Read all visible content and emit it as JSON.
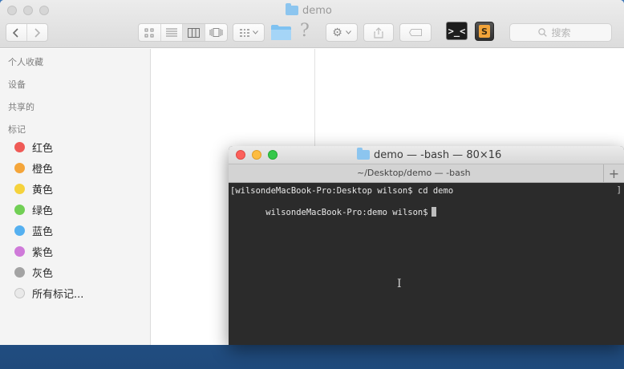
{
  "finder": {
    "title": "demo",
    "search_placeholder": "搜索",
    "sidebar": {
      "sections": [
        "个人收藏",
        "设备",
        "共享的",
        "标记"
      ],
      "tags": [
        {
          "label": "红色",
          "color": "#ef5a56"
        },
        {
          "label": "橙色",
          "color": "#f4a53a"
        },
        {
          "label": "黄色",
          "color": "#f5d23c"
        },
        {
          "label": "绿色",
          "color": "#71cf55"
        },
        {
          "label": "蓝色",
          "color": "#55b0f0"
        },
        {
          "label": "紫色",
          "color": "#cf7ad9"
        },
        {
          "label": "灰色",
          "color": "#a3a3a3"
        }
      ],
      "all_tags_label": "所有标记..."
    }
  },
  "terminal": {
    "title": "demo — -bash — 80×16",
    "tab_label": "~/Desktop/demo — -bash",
    "tab_add": "+",
    "lines": [
      "[wilsondeMacBook-Pro:Desktop wilson$ cd demo",
      " wilsondeMacBook-Pro:demo wilson$"
    ],
    "traffic_colors": [
      "#fc605b",
      "#fdbc40",
      "#34c84a"
    ]
  },
  "icons": {
    "back": "chevron-left-icon",
    "forward": "chevron-right-icon",
    "help": "?",
    "terminal_app": ">_<"
  }
}
